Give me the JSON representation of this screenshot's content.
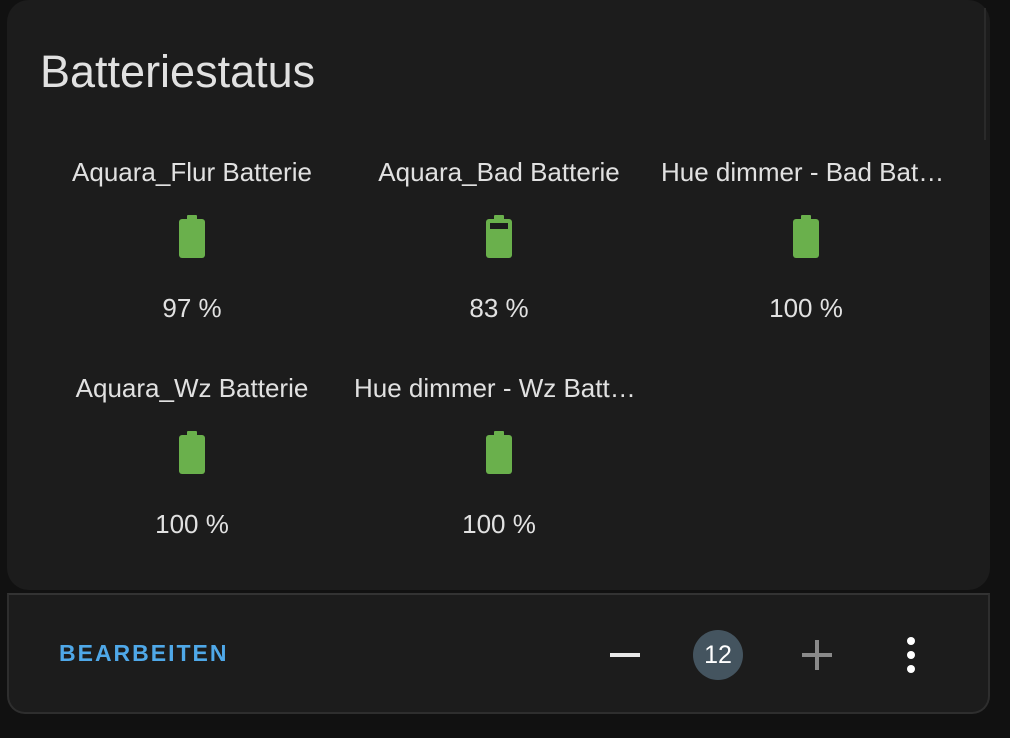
{
  "card": {
    "title": "Batteriestatus",
    "entities": [
      {
        "name": "Aquara_Flur Batterie",
        "state": "97 %",
        "icon": "battery-full-icon",
        "level": 97
      },
      {
        "name": "Aquara_Bad Batterie",
        "state": "83 %",
        "icon": "battery-80-icon",
        "level": 83
      },
      {
        "name": "Hue dimmer - Bad Batterie",
        "state": "100 %",
        "icon": "battery-full-icon",
        "level": 100
      },
      {
        "name": "Aquara_Wz Batterie",
        "state": "100 %",
        "icon": "battery-full-icon",
        "level": 100
      },
      {
        "name": "Hue dimmer - Wz Batterie",
        "state": "100 %",
        "icon": "battery-full-icon",
        "level": 100
      }
    ]
  },
  "footer": {
    "edit_label": "BEARBEITEN",
    "order_value": "12",
    "minus_icon": "minus-icon",
    "plus_icon": "plus-icon",
    "more_icon": "dots-vertical-icon"
  },
  "colors": {
    "battery": "#6ab04c",
    "accent": "#4fa8e8",
    "badge": "#44545f"
  }
}
